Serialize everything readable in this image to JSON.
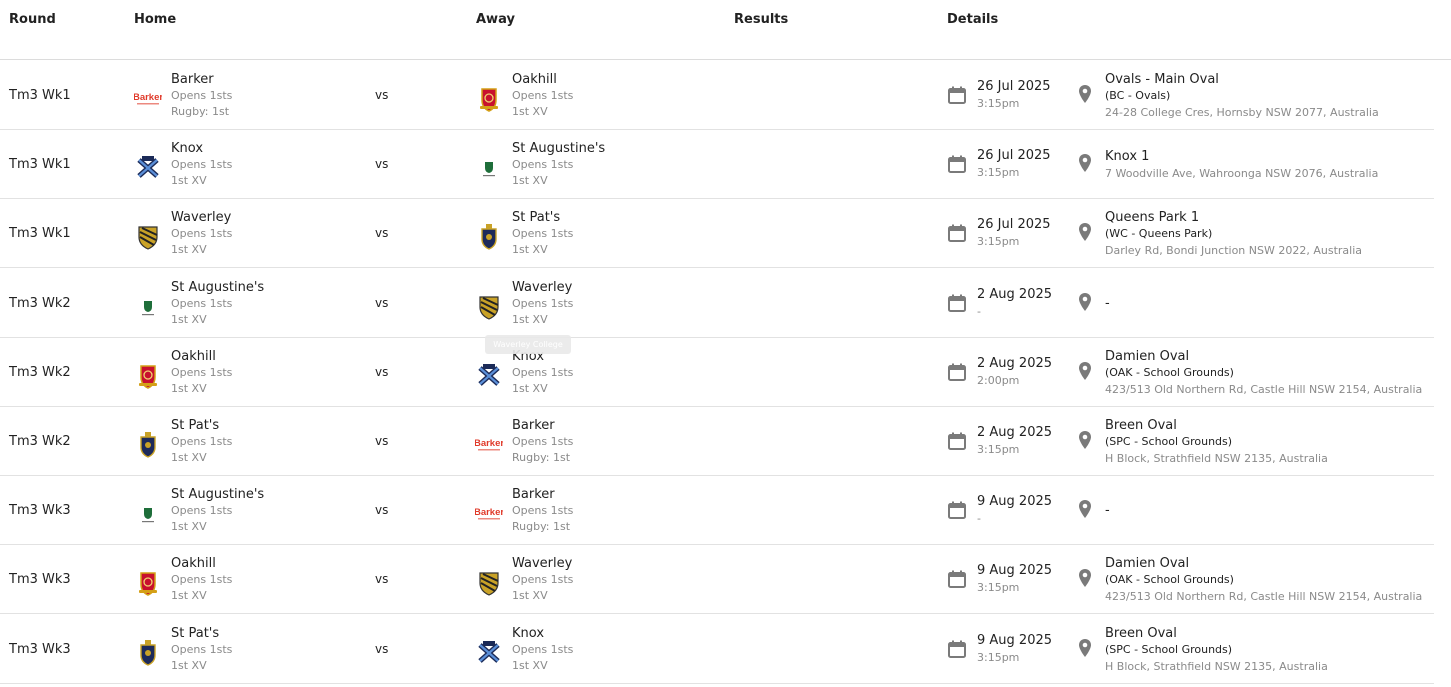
{
  "header": {
    "round": "Round",
    "home": "Home",
    "away": "Away",
    "results": "Results",
    "details": "Details"
  },
  "vs_label": "vs",
  "tooltip": "Waverley College",
  "colors": {
    "barker_red": "#e03a2a",
    "oakhill_red": "#c8102e",
    "knox_navy": "#1b2a57",
    "waverley_gold": "#c9a227",
    "stpats_navy": "#1d2a5a",
    "staug_green": "#1e6e3a",
    "icon_grey": "#7a7a7a"
  },
  "fixtures": [
    {
      "round": "Tm3 Wk1",
      "home": {
        "logo": "barker-logo",
        "name": "Barker",
        "sub1": "Opens 1sts",
        "sub2": "Rugby: 1st"
      },
      "away": {
        "logo": "oakhill-logo",
        "name": "Oakhill",
        "sub1": "Opens 1sts",
        "sub2": "1st XV"
      },
      "date": "26 Jul 2025",
      "time": "3:15pm",
      "venue": {
        "line1": "Ovals - Main Oval",
        "line2": "(BC - Ovals)",
        "line3": "24-28 College Cres, Hornsby NSW 2077, Australia"
      }
    },
    {
      "round": "Tm3 Wk1",
      "home": {
        "logo": "knox-logo",
        "name": "Knox",
        "sub1": "Opens 1sts",
        "sub2": "1st XV"
      },
      "away": {
        "logo": "st-augustines-logo",
        "name": "St Augustine's",
        "sub1": "Opens 1sts",
        "sub2": "1st XV"
      },
      "date": "26 Jul 2025",
      "time": "3:15pm",
      "venue": {
        "line1": "Knox 1",
        "line2": "",
        "line3": "7 Woodville Ave, Wahroonga NSW 2076, Australia"
      }
    },
    {
      "round": "Tm3 Wk1",
      "home": {
        "logo": "waverley-logo",
        "name": "Waverley",
        "sub1": "Opens 1sts",
        "sub2": "1st XV"
      },
      "away": {
        "logo": "st-pats-logo",
        "name": "St Pat's",
        "sub1": "Opens 1sts",
        "sub2": "1st XV"
      },
      "date": "26 Jul 2025",
      "time": "3:15pm",
      "venue": {
        "line1": "Queens Park 1",
        "line2": "(WC - Queens Park)",
        "line3": "Darley Rd, Bondi Junction NSW 2022, Australia"
      }
    },
    {
      "round": "Tm3 Wk2",
      "home": {
        "logo": "st-augustines-logo",
        "name": "St Augustine's",
        "sub1": "Opens 1sts",
        "sub2": "1st XV"
      },
      "away": {
        "logo": "waverley-logo",
        "name": "Waverley",
        "sub1": "Opens 1sts",
        "sub2": "1st XV"
      },
      "date": "2 Aug 2025",
      "time": "-",
      "venue": {
        "line1": "-",
        "line2": "",
        "line3": ""
      }
    },
    {
      "round": "Tm3 Wk2",
      "home": {
        "logo": "oakhill-logo",
        "name": "Oakhill",
        "sub1": "Opens 1sts",
        "sub2": "1st XV"
      },
      "away": {
        "logo": "knox-logo",
        "name": "Knox",
        "sub1": "Opens 1sts",
        "sub2": "1st XV"
      },
      "date": "2 Aug 2025",
      "time": "2:00pm",
      "venue": {
        "line1": "Damien Oval",
        "line2": "(OAK - School Grounds)",
        "line3": "423/513 Old Northern Rd, Castle Hill NSW 2154, Australia"
      }
    },
    {
      "round": "Tm3 Wk2",
      "home": {
        "logo": "st-pats-logo",
        "name": "St Pat's",
        "sub1": "Opens 1sts",
        "sub2": "1st XV"
      },
      "away": {
        "logo": "barker-logo",
        "name": "Barker",
        "sub1": "Opens 1sts",
        "sub2": "Rugby: 1st"
      },
      "date": "2 Aug 2025",
      "time": "3:15pm",
      "venue": {
        "line1": "Breen Oval",
        "line2": "(SPC - School Grounds)",
        "line3": "H Block, Strathfield NSW 2135, Australia"
      }
    },
    {
      "round": "Tm3 Wk3",
      "home": {
        "logo": "st-augustines-logo",
        "name": "St Augustine's",
        "sub1": "Opens 1sts",
        "sub2": "1st XV"
      },
      "away": {
        "logo": "barker-logo",
        "name": "Barker",
        "sub1": "Opens 1sts",
        "sub2": "Rugby: 1st"
      },
      "date": "9 Aug 2025",
      "time": "-",
      "venue": {
        "line1": "-",
        "line2": "",
        "line3": ""
      }
    },
    {
      "round": "Tm3 Wk3",
      "home": {
        "logo": "oakhill-logo",
        "name": "Oakhill",
        "sub1": "Opens 1sts",
        "sub2": "1st XV"
      },
      "away": {
        "logo": "waverley-logo",
        "name": "Waverley",
        "sub1": "Opens 1sts",
        "sub2": "1st XV"
      },
      "date": "9 Aug 2025",
      "time": "3:15pm",
      "venue": {
        "line1": "Damien Oval",
        "line2": "(OAK - School Grounds)",
        "line3": "423/513 Old Northern Rd, Castle Hill NSW 2154, Australia"
      }
    },
    {
      "round": "Tm3 Wk3",
      "home": {
        "logo": "st-pats-logo",
        "name": "St Pat's",
        "sub1": "Opens 1sts",
        "sub2": "1st XV"
      },
      "away": {
        "logo": "knox-logo",
        "name": "Knox",
        "sub1": "Opens 1sts",
        "sub2": "1st XV"
      },
      "date": "9 Aug 2025",
      "time": "3:15pm",
      "venue": {
        "line1": "Breen Oval",
        "line2": "(SPC - School Grounds)",
        "line3": "H Block, Strathfield NSW 2135, Australia"
      }
    }
  ]
}
